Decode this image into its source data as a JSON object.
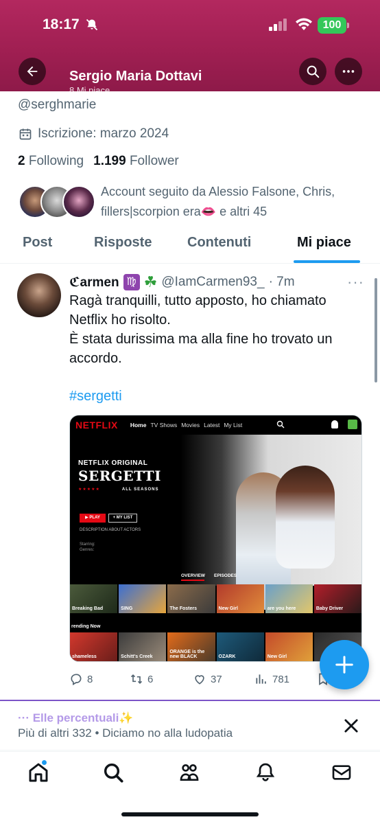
{
  "status_bar": {
    "time": "18:17",
    "battery": "100"
  },
  "header": {
    "name": "Sergio Maria Dottavi",
    "subtitle": "8 Mi piace"
  },
  "profile": {
    "handle": "@serghmarie",
    "joined": "Iscrizione: marzo 2024",
    "following_count": "2",
    "following_label": "Following",
    "followers_count": "1.199",
    "followers_label": "Follower",
    "followed_by": "Account seguito da Alessio Falsone, Chris, fillers|scorpion era👄 e altri 45"
  },
  "tabs": [
    {
      "label": "Post"
    },
    {
      "label": "Risposte"
    },
    {
      "label": "Contenuti"
    },
    {
      "label": "Mi piace",
      "active": true
    }
  ],
  "tweet": {
    "name": "ℭarmen",
    "handle": "@IamCarmen93_",
    "time": "· 7m",
    "text": "Ragà tranquilli, tutto apposto, ho chiamato Netflix ho risolto.\nÈ stata durissima ma alla fine ho trovato un accordo.",
    "hashtag": "#sergetti",
    "media": {
      "logo": "NETFLIX",
      "nav": [
        "Home",
        "TV Shows",
        "Movies",
        "Latest",
        "My List"
      ],
      "original_label": "NETFLIX ORIGINAL",
      "title": "SERGETTI",
      "subtitle": "ALL SEASONS",
      "play": "▶ PLAY",
      "my_list": "+ MY LIST",
      "description": "DESCRIPTION ABOUT ACTORS",
      "starring": "Starring:",
      "genres": "Genres:",
      "tab_overview": "OVERVIEW",
      "tab_episodes": "EPISODES",
      "trending": "rending Now",
      "row1": [
        "Breaking Bad",
        "SING",
        "The Fosters",
        "New Girl",
        "are you here",
        "Baby Driver"
      ],
      "row2": [
        "shameless",
        "Schitt's Creek",
        "ORANGE is the new BLACK",
        "OZARK",
        "New Girl",
        ""
      ]
    },
    "stats": {
      "replies": "8",
      "retweets": "6",
      "likes": "37",
      "views": "781"
    }
  },
  "notification": {
    "title": "··· Elle percentuali✨",
    "subtitle": "Più di altri 332 • Diciamo no alla ludopatia"
  },
  "colors": {
    "accent": "#1d9bf0",
    "banner": "#a01f52",
    "netflix_red": "#e50914"
  }
}
